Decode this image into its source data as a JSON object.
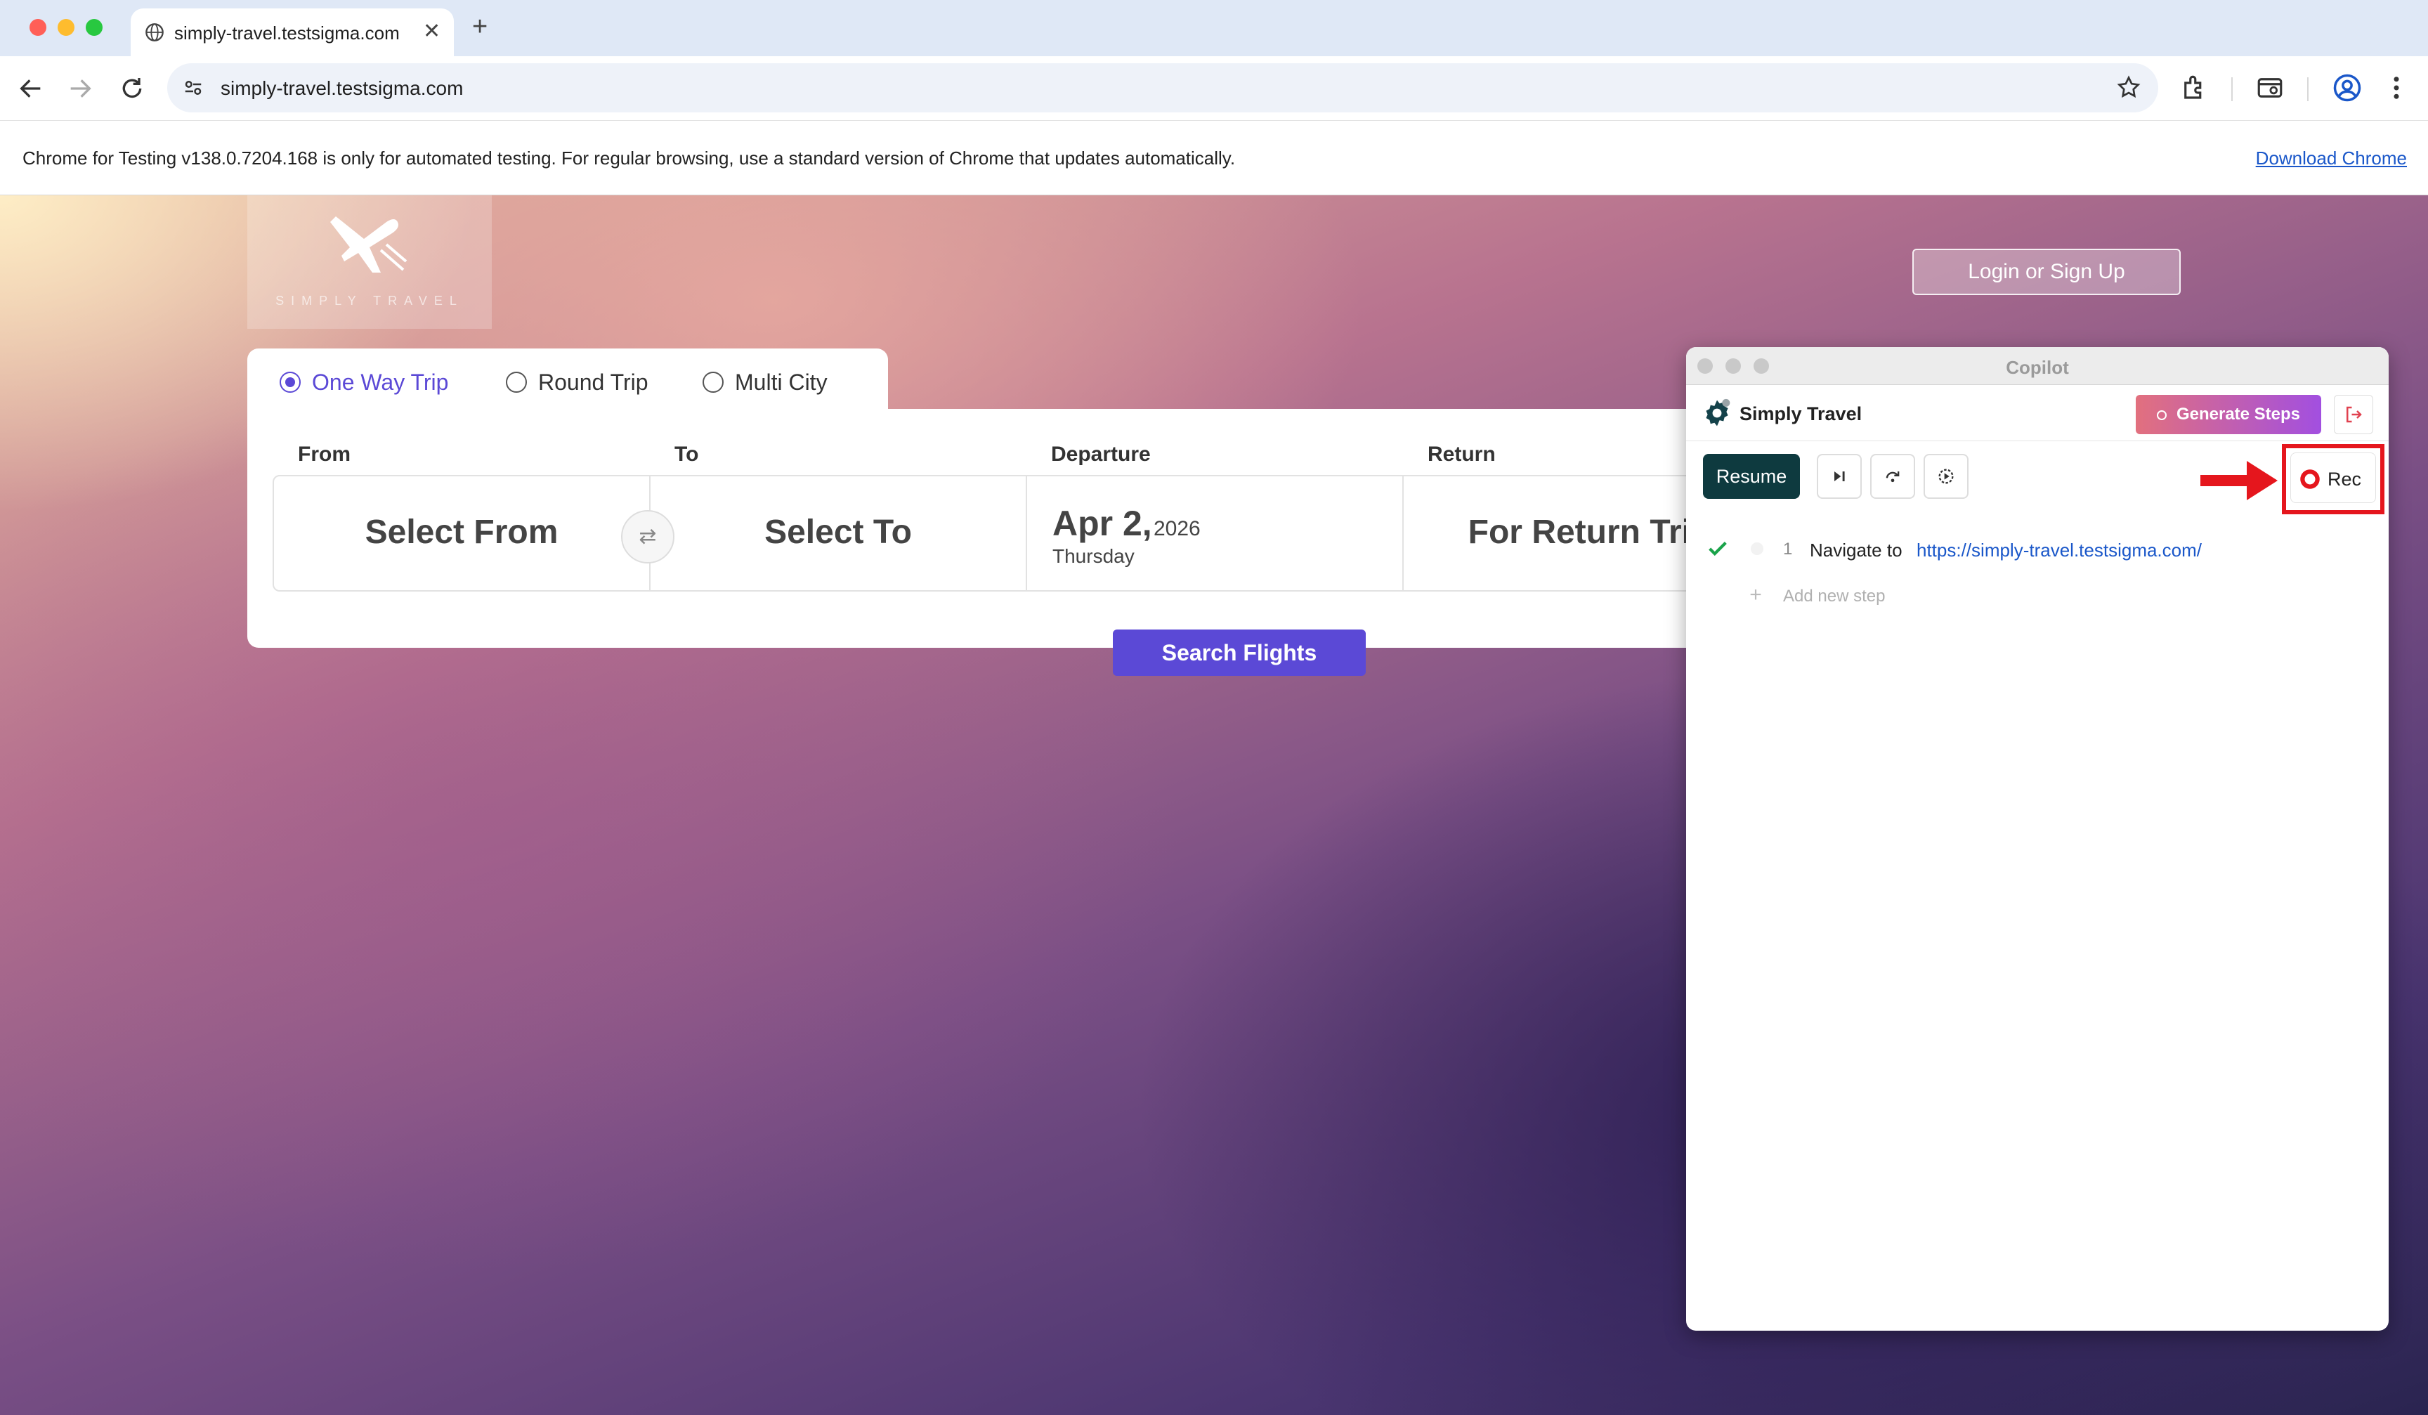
{
  "browser": {
    "tab_title": "simply-travel.testsigma.com",
    "new_tab_symbol": "+",
    "close_tab_symbol": "✕",
    "url": "simply-travel.testsigma.com",
    "info_message": "Chrome for Testing v138.0.7204.168 is only for automated testing. For regular browsing, use a standard version of Chrome that updates automatically.",
    "info_link": "Download Chrome"
  },
  "site": {
    "logo_text": "SIMPLY TRAVEL",
    "login_button": "Login or Sign Up",
    "trip_types": [
      "One Way Trip",
      "Round Trip",
      "Multi City"
    ],
    "selected_trip": "One Way Trip",
    "labels": {
      "from": "From",
      "to": "To",
      "departure": "Departure",
      "return": "Return"
    },
    "from_value": "Select From",
    "to_value": "Select To",
    "swap_symbol": "⇄",
    "departure": {
      "date": "Apr 2,",
      "year": "2026",
      "weekday": "Thursday"
    },
    "return_value": "For Return Trip",
    "search_button": "Search Flights"
  },
  "copilot": {
    "window_title": "Copilot",
    "project_name": "Simply Travel",
    "generate_button": "Generate Steps",
    "resume_button": "Resume",
    "rec_button": "Rec",
    "steps": [
      {
        "number": "1",
        "action": "Navigate to",
        "url": "https://simply-travel.testsigma.com/",
        "status": "passed"
      }
    ],
    "add_step_label": "Add new step"
  },
  "colors": {
    "accent_purple": "#5b49d6",
    "resume_dark_teal": "#0e3a3f",
    "highlight_red": "#e5161d",
    "link_blue": "#1a57c9"
  },
  "icons": [
    "globe-icon",
    "back-icon",
    "forward-icon",
    "reload-icon",
    "site-settings-icon",
    "star-icon",
    "extensions-icon",
    "tab-search-icon",
    "profile-icon",
    "menu-icon",
    "plane-icon",
    "gear-icon",
    "exit-icon",
    "step-over-icon",
    "redo-icon",
    "replay-icon",
    "record-icon",
    "check-icon",
    "arrow-icon"
  ]
}
